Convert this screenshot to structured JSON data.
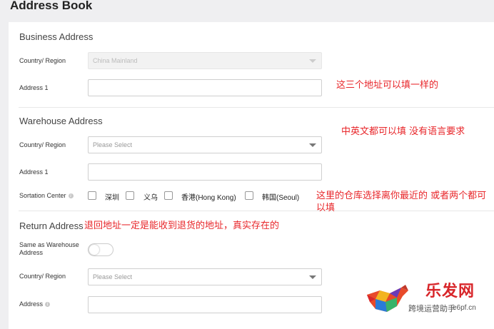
{
  "page": {
    "title": "Address Book"
  },
  "business": {
    "title": "Business Address",
    "country_label": "Country/ Region",
    "country_value": "China Mainland",
    "address_label": "Address 1"
  },
  "warehouse": {
    "title": "Warehouse Address",
    "country_label": "Country/ Region",
    "country_placeholder": "Please Select",
    "address_label": "Address 1",
    "sortation_label": "Sortation Center",
    "sortation_options": [
      "深圳",
      "义乌",
      "香港(Hong Kong)",
      "韩国(Seoul)"
    ]
  },
  "return": {
    "title": "Return Address",
    "same_as_label": "Same as Warehouse Address",
    "country_label": "Country/ Region",
    "country_placeholder": "Please Select",
    "address_label": "Address"
  },
  "notes": {
    "note1": "这三个地址可以填一样的",
    "note2": "中英文都可以填 没有语言要求",
    "note3": "这里的仓库选择离你最近的 或者两个都可以填",
    "note4": "退回地址一定是能收到退货的地址，真实存在的"
  },
  "watermark": {
    "text1": "跨境运营助手",
    "text2": "乐发网",
    "url": "e6pf.cn"
  },
  "colors": {
    "annotation": "#e8262a",
    "background": "#efeff1"
  }
}
